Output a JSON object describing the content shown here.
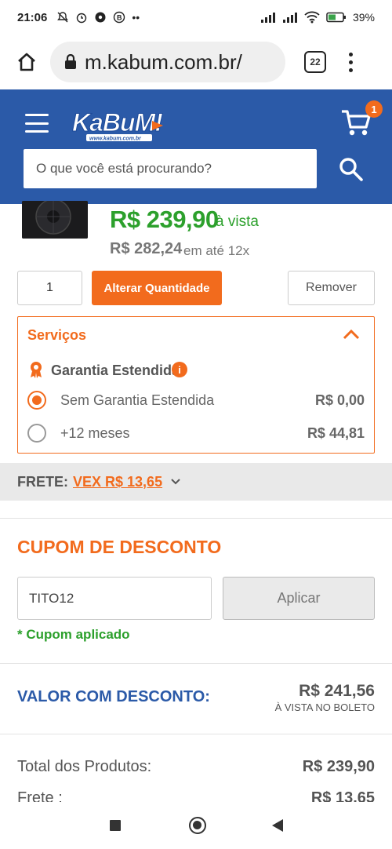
{
  "status_bar": {
    "time": "21:06",
    "battery": "39%"
  },
  "browser": {
    "url": "m.kabum.com.br/",
    "tabs_count": "22"
  },
  "header": {
    "logo_text": "KaBuM!",
    "logo_sub": "www.kabum.com.br",
    "cart_count": "1",
    "search_placeholder": "O que você está procurando?"
  },
  "product": {
    "price": "R$ 239,90",
    "price_suffix": "à vista",
    "installment_price": "R$ 282,24",
    "installment_suffix": "em até 12x",
    "quantity": "1",
    "change_qty_label": "Alterar Quantidade",
    "remove_label": "Remover"
  },
  "services": {
    "title": "Serviços",
    "warranty_label": "Garantia Estendida",
    "info": "i",
    "options": [
      {
        "label": "Sem Garantia Estendida",
        "value": "R$ 0,00",
        "selected": true
      },
      {
        "label": "+12 meses",
        "value": "R$ 44,81",
        "selected": false
      }
    ]
  },
  "frete": {
    "label": "FRETE:",
    "value": "VEX R$ 13,65"
  },
  "coupon": {
    "title": "CUPOM DE DESCONTO",
    "code": "TITO12",
    "apply_label": "Aplicar",
    "applied_msg": "* Cupom aplicado"
  },
  "totals": {
    "discount_label": "VALOR COM DESCONTO:",
    "discount_value": "R$ 241,56",
    "discount_sub": "À VISTA NO BOLETO",
    "products_label": "Total dos Produtos:",
    "products_value": "R$ 239,90",
    "frete_label": "Frete :",
    "frete_value": "R$ 13,65"
  },
  "colors": {
    "brand_blue": "#2b5aa8",
    "accent_orange": "#f26b1d",
    "price_green": "#2ca02c"
  }
}
